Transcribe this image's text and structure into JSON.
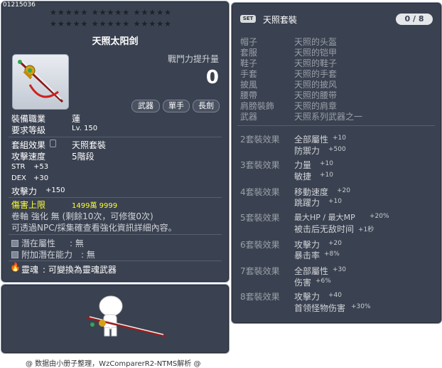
{
  "item": {
    "code": "01215036",
    "name": "天照太阳剑",
    "power_label": "戰鬥力提升量",
    "power_value": "0",
    "tags": [
      "武器",
      "單手",
      "長劍"
    ],
    "req_job_label": "裝備職業",
    "req_job_value": "蓮",
    "req_level_label": "要求等級",
    "req_level_value": "Lv. 150",
    "set_label": "套組效果",
    "set_value": "天照套裝",
    "speed_label": "攻擊速度",
    "speed_value": "5階段",
    "stats": [
      {
        "label": "STR",
        "value": "+53"
      },
      {
        "label": "DEX",
        "value": "+30"
      },
      {
        "label": "攻擊力",
        "value": "+150"
      }
    ],
    "damage_cap_label": "傷害上限",
    "damage_cap_value": "1499萬 9999",
    "upgrade_text": "卷軸 強化 無 (剩餘10次，可修復0次)",
    "npc_text": "可透過NPC/採集確查看強化資訊詳細內容。",
    "potential_label": "潛在屬性",
    "potential_value": ": 無",
    "add_potential_label": "附加潛在能力",
    "add_potential_value": ": 無",
    "soul_label": "靈魂",
    "soul_value": ": 可變換為靈魂武器"
  },
  "set": {
    "badge": "SET",
    "name": "天照套裝",
    "count": "0 / 8",
    "pieces": [
      {
        "slot": "帽子",
        "name": "天照的头盔"
      },
      {
        "slot": "套服",
        "name": "天照的铠甲"
      },
      {
        "slot": "鞋子",
        "name": "天照的鞋子"
      },
      {
        "slot": "手套",
        "name": "天照的手套"
      },
      {
        "slot": "披風",
        "name": "天照的披风"
      },
      {
        "slot": "腰帶",
        "name": "天照的腰带"
      },
      {
        "slot": "肩膀裝飾",
        "name": "天照的肩章"
      },
      {
        "slot": "武器",
        "name": "天照系列武器之一"
      }
    ],
    "effects": [
      {
        "label": "2套裝效果",
        "lines": [
          {
            "stat": "全部屬性",
            "val": "+10"
          },
          {
            "stat": "防禦力",
            "val": "+500"
          }
        ]
      },
      {
        "label": "3套裝效果",
        "lines": [
          {
            "stat": "力量",
            "val": "+10"
          },
          {
            "stat": "敏捷",
            "val": "+10"
          }
        ]
      },
      {
        "label": "4套裝效果",
        "lines": [
          {
            "stat": "移動速度",
            "val": "+20"
          },
          {
            "stat": "跳躍力",
            "val": "+10"
          }
        ]
      },
      {
        "label": "5套裝效果",
        "lines": [
          {
            "stat": "最大HP / 最大MP",
            "val": "+20%"
          },
          {
            "stat": "被击后无敌时间",
            "val": "+1秒"
          }
        ]
      },
      {
        "label": "6套裝效果",
        "lines": [
          {
            "stat": "攻擊力",
            "val": "+20"
          },
          {
            "stat": "暴击率",
            "val": "+8%"
          }
        ]
      },
      {
        "label": "7套裝效果",
        "lines": [
          {
            "stat": "全部屬性",
            "val": "+30"
          },
          {
            "stat": "伤害",
            "val": "+6%"
          }
        ]
      },
      {
        "label": "8套裝效果",
        "lines": [
          {
            "stat": "攻擊力",
            "val": "+40"
          },
          {
            "stat": "首领怪物伤害",
            "val": "+30%"
          }
        ]
      }
    ]
  },
  "footer": "@ 数据由小册子整理，WzComparerR2-NTMS解析 @"
}
